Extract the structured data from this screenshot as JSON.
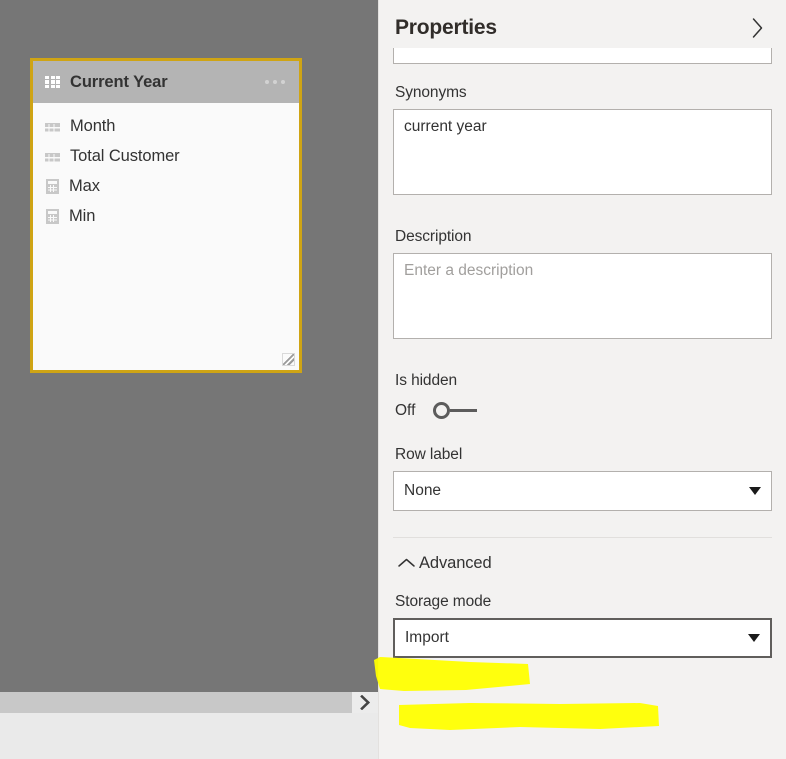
{
  "canvas": {
    "table_card": {
      "icon": "table-grid-icon",
      "title": "Current Year",
      "menu_icon": "ellipsis-icon",
      "resize_handle_icon": "resize-handle-icon",
      "border_color": "#cfa414",
      "header_bg": "#b4b4b4",
      "fields": [
        {
          "label": "Month",
          "icon": "column-icon",
          "kind": "column"
        },
        {
          "label": "Total Customer",
          "icon": "column-icon",
          "kind": "column"
        },
        {
          "label": "Max",
          "icon": "measure-icon",
          "kind": "measure"
        },
        {
          "label": "Min",
          "icon": "measure-icon",
          "kind": "measure"
        }
      ]
    },
    "background_color": "#767676",
    "expand_pane_icon": "chevron-right-icon"
  },
  "properties": {
    "title": "Properties",
    "collapse_icon": "chevron-right-icon",
    "name": {
      "value": "",
      "placeholder": ""
    },
    "synonyms": {
      "label": "Synonyms",
      "value": "current year",
      "placeholder": ""
    },
    "description": {
      "label": "Description",
      "value": "",
      "placeholder": "Enter a description"
    },
    "is_hidden": {
      "label": "Is hidden",
      "state_label": "Off",
      "checked": false
    },
    "row_label": {
      "label": "Row label",
      "value": "None",
      "caret_icon": "caret-down-icon"
    },
    "advanced": {
      "label": "Advanced",
      "expanded": true,
      "collapse_icon": "chevron-up-icon",
      "storage_mode": {
        "label": "Storage mode",
        "value": "Import",
        "caret_icon": "caret-down-icon"
      }
    }
  },
  "annotations": {
    "highlight_color": "#ffff00",
    "marks": [
      {
        "target": "storage-mode-label",
        "note": "yellow marker over Storage mode label"
      },
      {
        "target": "storage-mode-value",
        "note": "yellow marker over Import value"
      }
    ]
  }
}
